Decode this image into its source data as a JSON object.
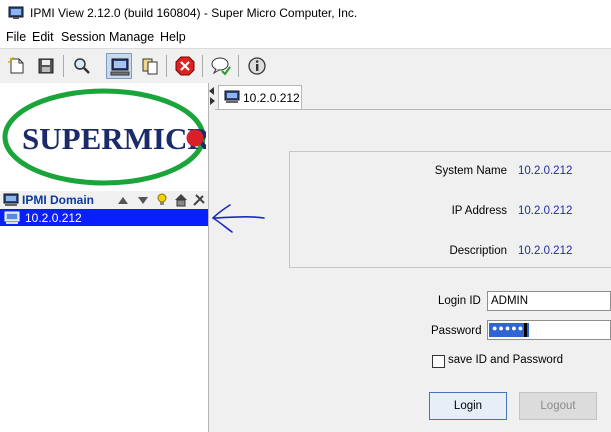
{
  "window": {
    "title": "IPMI View 2.12.0 (build 160804) - Super Micro Computer, Inc."
  },
  "menu": [
    "File",
    "Edit",
    "Session",
    "Manage",
    "Help"
  ],
  "toolbar": {
    "buttons": [
      "new-icon",
      "save-icon",
      "search-icon",
      "monitor-icon",
      "copy-icon",
      "stop-icon",
      "chat-icon",
      "info-icon"
    ],
    "active": "monitor-icon"
  },
  "logo": {
    "brand": "SUPERMICR"
  },
  "tree": {
    "domain_label": "IPMI Domain",
    "domain_icons": [
      "up-arrow-icon",
      "down-arrow-icon",
      "bulb-icon",
      "house-icon",
      "tools-icon"
    ],
    "items": [
      {
        "label": "10.2.0.212",
        "selected": true
      }
    ]
  },
  "tab": {
    "label": "10.2.0.212"
  },
  "info": {
    "system_name_label": "System Name",
    "system_name": "10.2.0.212",
    "ip_label": "IP Address",
    "ip": "10.2.0.212",
    "desc_label": "Description",
    "desc": "10.2.0.212"
  },
  "login": {
    "id_label": "Login ID",
    "id_value": "ADMIN",
    "pwd_label": "Password",
    "pwd_mask": "●●●●●",
    "save_label": "save ID and Password",
    "login_button": "Login",
    "logout_button": "Logout"
  },
  "colors": {
    "selection": "#0a1fff",
    "domain_text": "#0a3aa0",
    "value_text": "#1d2fa8",
    "logo_green": "#1aa53a",
    "logo_navy": "#1b2a6b",
    "logo_red": "#d9202a",
    "annotation": "#1a2bbf"
  }
}
